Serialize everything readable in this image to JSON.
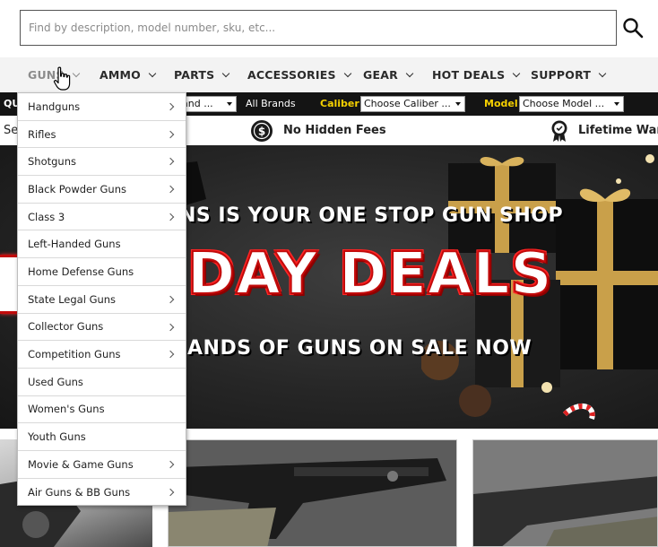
{
  "search": {
    "placeholder": "Find by description, model number, sku, etc..."
  },
  "nav": {
    "items": [
      {
        "label": "GUNS",
        "active": true
      },
      {
        "label": "AMMO"
      },
      {
        "label": "PARTS"
      },
      {
        "label": "ACCESSORIES"
      },
      {
        "label": "GEAR"
      },
      {
        "label": "HOT DEALS"
      },
      {
        "label": "SUPPORT"
      }
    ]
  },
  "filterbar": {
    "quick_label": "QU",
    "brand_select": "and ...",
    "brands_text": "All Brands",
    "caliber_label": "Caliber",
    "caliber_select": "Choose Caliber ...",
    "model_label": "Model",
    "model_select": "Choose Model ..."
  },
  "benefits": {
    "left_partial": "Se",
    "fees": "No Hidden Fees",
    "warranty": "Lifetime Warra"
  },
  "hero": {
    "line1": "NS IS YOUR ONE STOP GUN SHOP",
    "line2": "DAY DEALS",
    "line3": "ANDS OF GUNS ON SALE NOW"
  },
  "dropdown": {
    "items": [
      {
        "label": "Handguns",
        "has_sub": true
      },
      {
        "label": "Rifles",
        "has_sub": true
      },
      {
        "label": "Shotguns",
        "has_sub": true
      },
      {
        "label": "Black Powder Guns",
        "has_sub": true
      },
      {
        "label": "Class 3",
        "has_sub": true
      },
      {
        "label": "Left-Handed Guns",
        "has_sub": false
      },
      {
        "label": "Home Defense Guns",
        "has_sub": false
      },
      {
        "label": "State Legal Guns",
        "has_sub": true
      },
      {
        "label": "Collector Guns",
        "has_sub": true
      },
      {
        "label": "Competition Guns",
        "has_sub": true
      },
      {
        "label": "Used Guns",
        "has_sub": false
      },
      {
        "label": "Women's Guns",
        "has_sub": false
      },
      {
        "label": "Youth Guns",
        "has_sub": false
      },
      {
        "label": "Movie & Game Guns",
        "has_sub": true
      },
      {
        "label": "Air Guns & BB Guns",
        "has_sub": true
      }
    ]
  },
  "colors": {
    "filter_label": "#f5d000",
    "hero_red": "#c20b0b",
    "nav_bg": "#f3f3f3"
  }
}
